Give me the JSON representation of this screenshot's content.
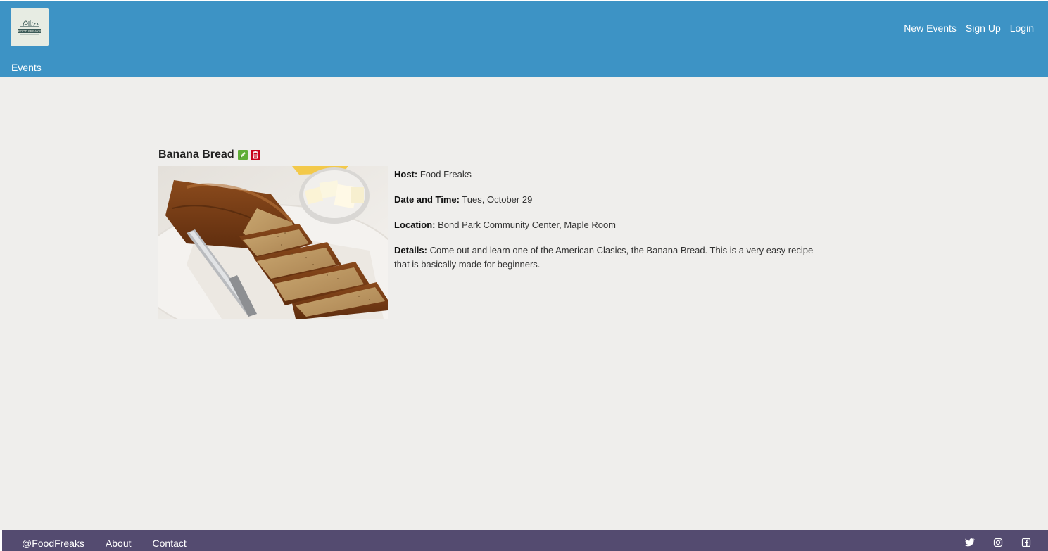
{
  "header": {
    "logo_text": "FOOD FREAKS",
    "nav": [
      {
        "label": "New Events"
      },
      {
        "label": "Sign Up"
      },
      {
        "label": "Login"
      }
    ],
    "sub_nav": {
      "label": "Events"
    }
  },
  "event": {
    "title": "Banana Bread",
    "edit_icon": "pencil-icon",
    "delete_icon": "trash-icon",
    "edit_color": "#5fae38",
    "delete_color": "#c8001a",
    "image_alt": "banana bread",
    "host_label": "Host:",
    "host": "Food Freaks",
    "date_label": "Date and Time:",
    "date": "Tues, October 29",
    "location_label": "Location:",
    "location": "Bond Park Community Center, Maple Room",
    "details_label": "Details:",
    "details": "Come out and learn one of the American Clasics, the Banana Bread. This is a very easy recipe that is basically made for beginners."
  },
  "footer": {
    "links": [
      {
        "label": "@FoodFreaks"
      },
      {
        "label": "About"
      },
      {
        "label": "Contact"
      }
    ],
    "social_icons": [
      "twitter-icon",
      "instagram-icon",
      "facebook-icon"
    ]
  },
  "colors": {
    "header_bg": "#3d93c5",
    "page_bg": "#efeeec",
    "footer_bg": "#544b70",
    "divider": "#4a3c86"
  }
}
